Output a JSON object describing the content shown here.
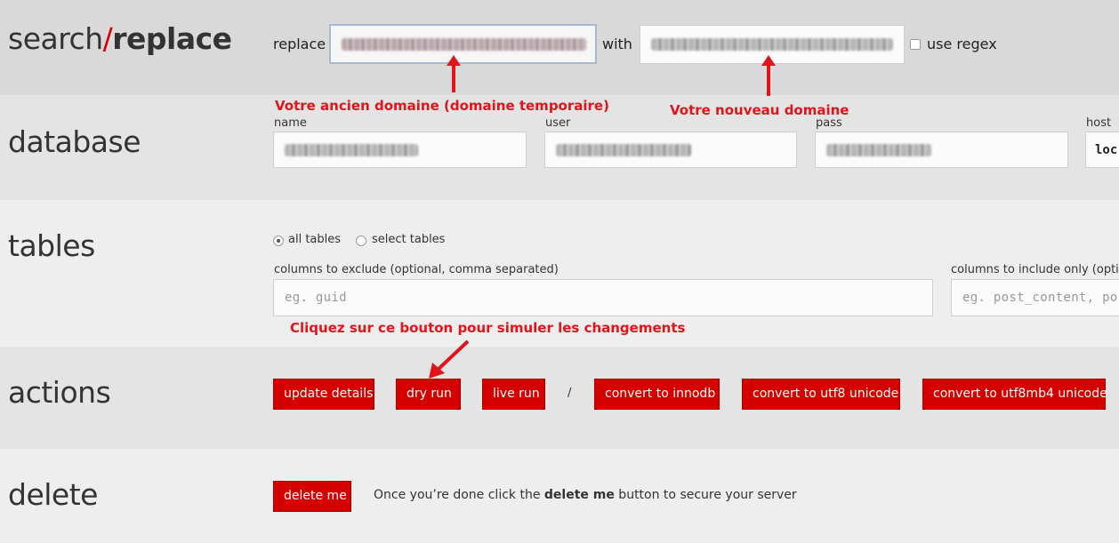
{
  "brand": {
    "part1": "search",
    "slash": "/",
    "part2": "replace"
  },
  "search": {
    "replace_label": "replace",
    "with_label": "with",
    "use_regex_label": "use regex",
    "use_regex_checked": false
  },
  "annotations": {
    "old_domain": "Votre ancien domaine (domaine temporaire)",
    "new_domain": "Votre nouveau domaine",
    "dry_run_hint": "Cliquez sur ce bouton pour simuler les changements"
  },
  "database": {
    "title": "database",
    "name_label": "name",
    "user_label": "user",
    "pass_label": "pass",
    "host_label": "host",
    "host_value": "loc"
  },
  "tables": {
    "title": "tables",
    "all_tables_label": "all tables",
    "select_tables_label": "select tables",
    "selected": "all tables",
    "exclude_label": "columns to exclude (optional, comma separated)",
    "exclude_placeholder": "eg. guid",
    "include_label": "columns to include only (opti",
    "include_placeholder": "eg. post_content, po"
  },
  "actions": {
    "title": "actions",
    "update_details": "update details",
    "dry_run": "dry run",
    "live_run": "live run",
    "separator": "/",
    "convert_innodb": "convert to innodb",
    "convert_utf8": "convert to utf8 unicode",
    "convert_utf8mb4": "convert to utf8mb4 unicode"
  },
  "delete": {
    "title": "delete",
    "button": "delete me",
    "message_before": "Once you’re done click the ",
    "message_bold": "delete me",
    "message_after": " button to secure your server"
  },
  "colors": {
    "accent": "#d50000",
    "annotation": "#e0151b"
  }
}
